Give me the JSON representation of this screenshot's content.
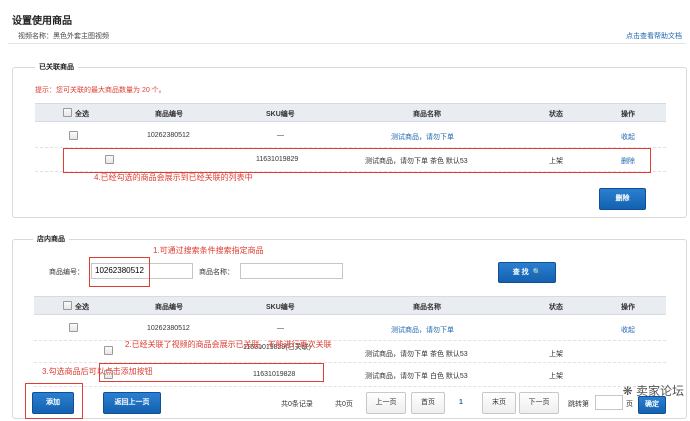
{
  "page": {
    "title": "设置使用商品",
    "video_name_label": "视频名称：黑色外套主图视频",
    "help_link": "点击查看帮助文档"
  },
  "linked": {
    "legend": "已关联商品",
    "tip": "提示：您可关联的最大商品数量为 20 个。",
    "columns": [
      "全选",
      "商品编号",
      "SKU编号",
      "商品名称",
      "状态",
      "操作"
    ],
    "rows": [
      {
        "id": "10262380512",
        "sku": "—",
        "name": "测试商品，请勿下单",
        "status": "",
        "action": "收起"
      },
      {
        "id": "",
        "sku": "11631019829",
        "name": "测试商品，请勿下单 茶色 默认53",
        "status": "上架",
        "action": "删除"
      }
    ],
    "delete_button": "删除",
    "note": "4.已经勾选的商品会展示到已经关联的列表中"
  },
  "store": {
    "legend": "店内商品",
    "search": {
      "id_label": "商品编号：",
      "id_value": "10262380512",
      "name_label": "商品名称：",
      "name_value": "",
      "button": "查 找"
    },
    "note_search": "1.可通过搜索条件搜索指定商品",
    "columns": [
      "全选",
      "商品编号",
      "SKU编号",
      "商品名称",
      "状态",
      "操作"
    ],
    "rows": [
      {
        "id": "10262380512",
        "sku": "—",
        "name": "测试商品，请勿下单",
        "status": "",
        "action": "收起"
      },
      {
        "id": "",
        "sku": "11631019829(已关联)",
        "name": "测试商品，请勿下单 茶色 默认53",
        "status": "上架",
        "action": ""
      },
      {
        "id": "",
        "sku": "11631019828",
        "name": "测试商品，请勿下单 白色 默认53",
        "status": "上架",
        "action": ""
      }
    ],
    "note_linked": "2.已经关联了视频的商品会展示已关联，不能进行再次关联",
    "note_add": "3.勾选商品后可以点击添加按钮",
    "add_button": "添加",
    "back_button": "返回上一页",
    "pagination": {
      "total_records": "共0条记录",
      "total_pages": "共0页",
      "prev": "上一页",
      "first": "首页",
      "current": "1",
      "last": "末页",
      "next": "下一页",
      "goto_label": "跳转第",
      "goto_suffix": "页",
      "confirm": "确定"
    }
  },
  "watermark": "卖家论坛",
  "colors": {
    "accent": "#1461b0",
    "annotation": "#e03c31"
  }
}
